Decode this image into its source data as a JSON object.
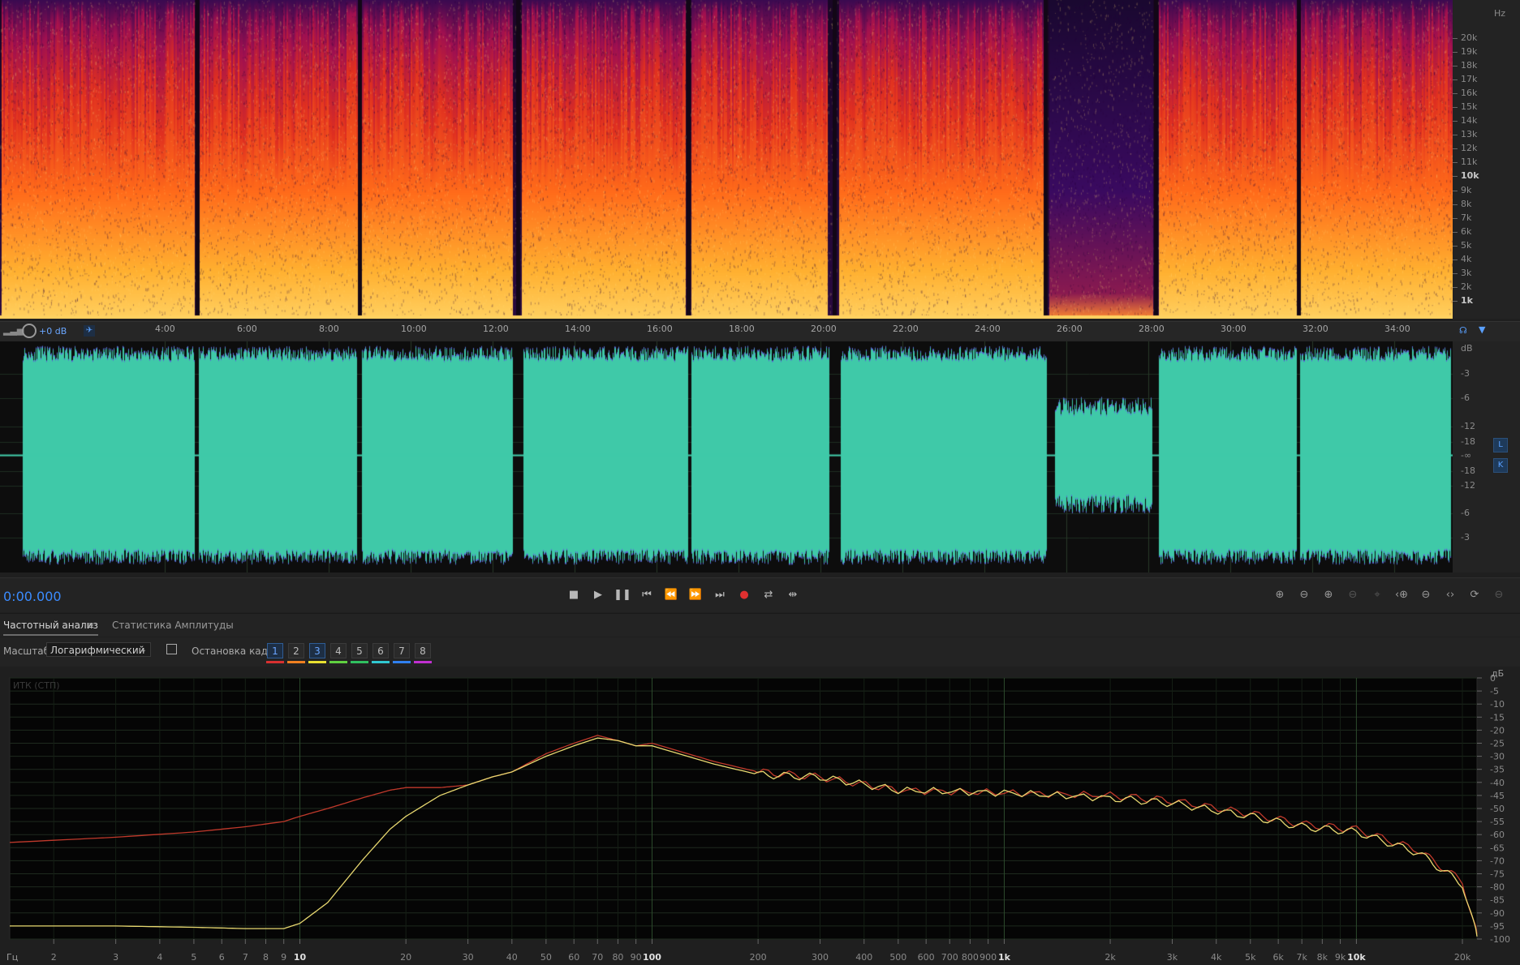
{
  "spectral": {
    "hz_label": "Hz",
    "hz_ticks": [
      {
        "label": "20k",
        "hz": 20000,
        "bold": false
      },
      {
        "label": "19k",
        "hz": 19000,
        "bold": false
      },
      {
        "label": "18k",
        "hz": 18000,
        "bold": false
      },
      {
        "label": "17k",
        "hz": 17000,
        "bold": false
      },
      {
        "label": "16k",
        "hz": 16000,
        "bold": false
      },
      {
        "label": "15k",
        "hz": 15000,
        "bold": false
      },
      {
        "label": "14k",
        "hz": 14000,
        "bold": false
      },
      {
        "label": "13k",
        "hz": 13000,
        "bold": false
      },
      {
        "label": "12k",
        "hz": 12000,
        "bold": false
      },
      {
        "label": "11k",
        "hz": 11000,
        "bold": false
      },
      {
        "label": "10k",
        "hz": 10000,
        "bold": true
      },
      {
        "label": "9k",
        "hz": 9000,
        "bold": false
      },
      {
        "label": "8k",
        "hz": 8000,
        "bold": false
      },
      {
        "label": "7k",
        "hz": 7000,
        "bold": false
      },
      {
        "label": "6k",
        "hz": 6000,
        "bold": false
      },
      {
        "label": "5k",
        "hz": 5000,
        "bold": false
      },
      {
        "label": "4k",
        "hz": 4000,
        "bold": false
      },
      {
        "label": "3k",
        "hz": 3000,
        "bold": false
      },
      {
        "label": "2k",
        "hz": 2000,
        "bold": false
      },
      {
        "label": "1k",
        "hz": 1000,
        "bold": true
      }
    ]
  },
  "timeline": {
    "gain_label": "+0 dB",
    "ticks": [
      "4:00",
      "6:00",
      "8:00",
      "10:00",
      "12:00",
      "14:00",
      "16:00",
      "18:00",
      "20:00",
      "22:00",
      "24:00",
      "26:00",
      "28:00",
      "30:00",
      "32:00",
      "34:00"
    ]
  },
  "waveform": {
    "db_label": "dB",
    "db_ticks": [
      "-3",
      "-6",
      "-12",
      "-18",
      "-∞",
      "-18",
      "-12",
      "-6",
      "-3"
    ],
    "channel_l": "L",
    "channel_r": "K",
    "color": "#3fc9a8"
  },
  "transport": {
    "time": "0:00.000"
  },
  "panel": {
    "tabs": [
      {
        "label": "Частотный анализ",
        "active": true
      },
      {
        "label": "Статистика Амплитуды",
        "active": false
      }
    ],
    "menu_icon": "≡"
  },
  "controls": {
    "scale_label": "Масштаб:",
    "scale_value": "Логарифмический",
    "freeze_label": "Остановка кадра:",
    "frames": [
      {
        "label": "1",
        "color": "#d83030",
        "selected": true
      },
      {
        "label": "2",
        "color": "#f08020",
        "selected": false
      },
      {
        "label": "3",
        "color": "#e8e030",
        "selected": true
      },
      {
        "label": "4",
        "color": "#60d040",
        "selected": false
      },
      {
        "label": "5",
        "color": "#30c060",
        "selected": false
      },
      {
        "label": "6",
        "color": "#30c8d0",
        "selected": false
      },
      {
        "label": "7",
        "color": "#3080f0",
        "selected": false
      },
      {
        "label": "8",
        "color": "#c030d0",
        "selected": false
      }
    ]
  },
  "chart_data": {
    "type": "line",
    "title": "ИТК (СТП)",
    "xlabel": "Гц",
    "ylabel": "дБ",
    "x_scale": "log",
    "xlim": [
      1.5,
      22000
    ],
    "ylim": [
      -100,
      0
    ],
    "x_tick_labels": [
      "2",
      "3",
      "4",
      "5",
      "6",
      "7",
      "8",
      "9",
      "10",
      "20",
      "30",
      "40",
      "50",
      "60",
      "70",
      "80",
      "90",
      "100",
      "200",
      "300",
      "400",
      "500",
      "600",
      "700",
      "800",
      "900",
      "1k",
      "2k",
      "3k",
      "4k",
      "5k",
      "6k",
      "7k",
      "8k",
      "9k",
      "10k",
      "20k"
    ],
    "x_tick_values": [
      2,
      3,
      4,
      5,
      6,
      7,
      8,
      9,
      10,
      20,
      30,
      40,
      50,
      60,
      70,
      80,
      90,
      100,
      200,
      300,
      400,
      500,
      600,
      700,
      800,
      900,
      1000,
      2000,
      3000,
      4000,
      5000,
      6000,
      7000,
      8000,
      9000,
      10000,
      20000
    ],
    "y_ticks": [
      0,
      -5,
      -10,
      -15,
      -20,
      -25,
      -30,
      -35,
      -40,
      -45,
      -50,
      -55,
      -60,
      -65,
      -70,
      -75,
      -80,
      -85,
      -90,
      -95,
      -100
    ],
    "grid": true,
    "series": [
      {
        "color": "#c0392b",
        "x": [
          1.5,
          3,
          5,
          7,
          9,
          10,
          12,
          15,
          18,
          20,
          25,
          30,
          35,
          40,
          50,
          60,
          70,
          80,
          90,
          100,
          150,
          200,
          300,
          500,
          1000,
          2000,
          3000,
          5000,
          7000,
          10000,
          15000,
          20000,
          22000
        ],
        "y": [
          -63,
          -61,
          -59,
          -57,
          -55,
          -53,
          -50,
          -46,
          -43,
          -42,
          -42,
          -41,
          -38,
          -36,
          -29,
          -25,
          -22,
          -24,
          -26,
          -25,
          -32,
          -36,
          -38,
          -43,
          -44,
          -45,
          -47,
          -52,
          -56,
          -58,
          -66,
          -78,
          -98
        ]
      },
      {
        "color": "#e8d870",
        "x": [
          1.5,
          3,
          5,
          7,
          9,
          10,
          12,
          15,
          18,
          20,
          25,
          30,
          35,
          40,
          50,
          60,
          70,
          80,
          90,
          100,
          150,
          200,
          300,
          500,
          1000,
          2000,
          3000,
          5000,
          7000,
          10000,
          15000,
          20000,
          22000
        ],
        "y": [
          -95,
          -95,
          -95.5,
          -96,
          -96,
          -94,
          -86,
          -70,
          -58,
          -53,
          -45,
          -41,
          -38,
          -36,
          -30,
          -26,
          -23,
          -24,
          -26,
          -26,
          -33,
          -37,
          -38,
          -43,
          -44,
          -46,
          -48,
          -53,
          -57,
          -59,
          -67,
          -79,
          -99
        ]
      }
    ]
  }
}
